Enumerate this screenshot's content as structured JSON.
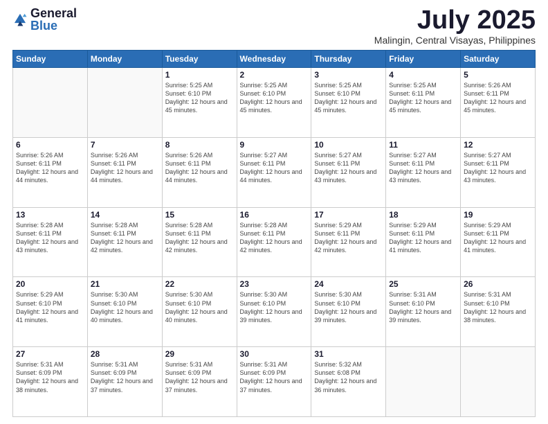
{
  "logo": {
    "general": "General",
    "blue": "Blue"
  },
  "title": "July 2025",
  "location": "Malingin, Central Visayas, Philippines",
  "days_of_week": [
    "Sunday",
    "Monday",
    "Tuesday",
    "Wednesday",
    "Thursday",
    "Friday",
    "Saturday"
  ],
  "weeks": [
    [
      {
        "day": "",
        "info": ""
      },
      {
        "day": "",
        "info": ""
      },
      {
        "day": "1",
        "info": "Sunrise: 5:25 AM\nSunset: 6:10 PM\nDaylight: 12 hours and 45 minutes."
      },
      {
        "day": "2",
        "info": "Sunrise: 5:25 AM\nSunset: 6:10 PM\nDaylight: 12 hours and 45 minutes."
      },
      {
        "day": "3",
        "info": "Sunrise: 5:25 AM\nSunset: 6:10 PM\nDaylight: 12 hours and 45 minutes."
      },
      {
        "day": "4",
        "info": "Sunrise: 5:25 AM\nSunset: 6:11 PM\nDaylight: 12 hours and 45 minutes."
      },
      {
        "day": "5",
        "info": "Sunrise: 5:26 AM\nSunset: 6:11 PM\nDaylight: 12 hours and 45 minutes."
      }
    ],
    [
      {
        "day": "6",
        "info": "Sunrise: 5:26 AM\nSunset: 6:11 PM\nDaylight: 12 hours and 44 minutes."
      },
      {
        "day": "7",
        "info": "Sunrise: 5:26 AM\nSunset: 6:11 PM\nDaylight: 12 hours and 44 minutes."
      },
      {
        "day": "8",
        "info": "Sunrise: 5:26 AM\nSunset: 6:11 PM\nDaylight: 12 hours and 44 minutes."
      },
      {
        "day": "9",
        "info": "Sunrise: 5:27 AM\nSunset: 6:11 PM\nDaylight: 12 hours and 44 minutes."
      },
      {
        "day": "10",
        "info": "Sunrise: 5:27 AM\nSunset: 6:11 PM\nDaylight: 12 hours and 43 minutes."
      },
      {
        "day": "11",
        "info": "Sunrise: 5:27 AM\nSunset: 6:11 PM\nDaylight: 12 hours and 43 minutes."
      },
      {
        "day": "12",
        "info": "Sunrise: 5:27 AM\nSunset: 6:11 PM\nDaylight: 12 hours and 43 minutes."
      }
    ],
    [
      {
        "day": "13",
        "info": "Sunrise: 5:28 AM\nSunset: 6:11 PM\nDaylight: 12 hours and 43 minutes."
      },
      {
        "day": "14",
        "info": "Sunrise: 5:28 AM\nSunset: 6:11 PM\nDaylight: 12 hours and 42 minutes."
      },
      {
        "day": "15",
        "info": "Sunrise: 5:28 AM\nSunset: 6:11 PM\nDaylight: 12 hours and 42 minutes."
      },
      {
        "day": "16",
        "info": "Sunrise: 5:28 AM\nSunset: 6:11 PM\nDaylight: 12 hours and 42 minutes."
      },
      {
        "day": "17",
        "info": "Sunrise: 5:29 AM\nSunset: 6:11 PM\nDaylight: 12 hours and 42 minutes."
      },
      {
        "day": "18",
        "info": "Sunrise: 5:29 AM\nSunset: 6:11 PM\nDaylight: 12 hours and 41 minutes."
      },
      {
        "day": "19",
        "info": "Sunrise: 5:29 AM\nSunset: 6:11 PM\nDaylight: 12 hours and 41 minutes."
      }
    ],
    [
      {
        "day": "20",
        "info": "Sunrise: 5:29 AM\nSunset: 6:10 PM\nDaylight: 12 hours and 41 minutes."
      },
      {
        "day": "21",
        "info": "Sunrise: 5:30 AM\nSunset: 6:10 PM\nDaylight: 12 hours and 40 minutes."
      },
      {
        "day": "22",
        "info": "Sunrise: 5:30 AM\nSunset: 6:10 PM\nDaylight: 12 hours and 40 minutes."
      },
      {
        "day": "23",
        "info": "Sunrise: 5:30 AM\nSunset: 6:10 PM\nDaylight: 12 hours and 39 minutes."
      },
      {
        "day": "24",
        "info": "Sunrise: 5:30 AM\nSunset: 6:10 PM\nDaylight: 12 hours and 39 minutes."
      },
      {
        "day": "25",
        "info": "Sunrise: 5:31 AM\nSunset: 6:10 PM\nDaylight: 12 hours and 39 minutes."
      },
      {
        "day": "26",
        "info": "Sunrise: 5:31 AM\nSunset: 6:10 PM\nDaylight: 12 hours and 38 minutes."
      }
    ],
    [
      {
        "day": "27",
        "info": "Sunrise: 5:31 AM\nSunset: 6:09 PM\nDaylight: 12 hours and 38 minutes."
      },
      {
        "day": "28",
        "info": "Sunrise: 5:31 AM\nSunset: 6:09 PM\nDaylight: 12 hours and 37 minutes."
      },
      {
        "day": "29",
        "info": "Sunrise: 5:31 AM\nSunset: 6:09 PM\nDaylight: 12 hours and 37 minutes."
      },
      {
        "day": "30",
        "info": "Sunrise: 5:31 AM\nSunset: 6:09 PM\nDaylight: 12 hours and 37 minutes."
      },
      {
        "day": "31",
        "info": "Sunrise: 5:32 AM\nSunset: 6:08 PM\nDaylight: 12 hours and 36 minutes."
      },
      {
        "day": "",
        "info": ""
      },
      {
        "day": "",
        "info": ""
      }
    ]
  ]
}
